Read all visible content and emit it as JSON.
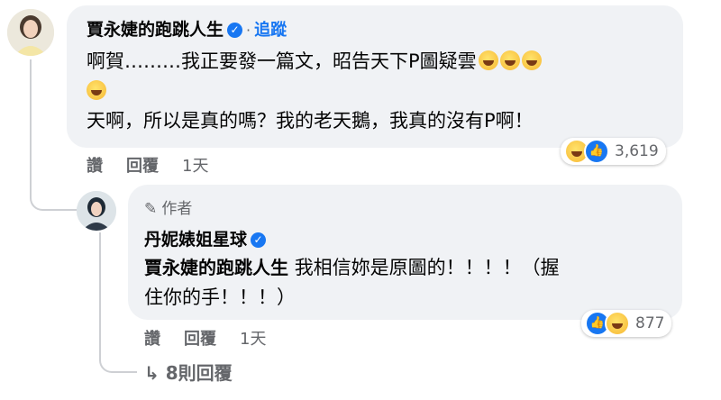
{
  "comment": {
    "author": "賈永婕的跑跳人生",
    "follow_label": "追蹤",
    "line1": "啊賀………我正要發一篇文，昭告天下P圖疑雲",
    "line3": "天啊，所以是真的嗎？我的老天鵝，我真的沒有P啊！",
    "like_label": "讚",
    "reply_label": "回覆",
    "time": "1天",
    "reaction_count": "3,619"
  },
  "reply": {
    "author_tag": "作者",
    "author": "丹妮婊姐星球",
    "mention": "賈永婕的跑跳人生",
    "text_line1": "我相信妳是原圖的！！！！（握",
    "text_line2": "住你的手！！！）",
    "like_label": "讚",
    "reply_label": "回覆",
    "time": "1天",
    "reaction_count": "877"
  },
  "more_replies": "8則回覆",
  "icons": {
    "verified": "verified-badge-icon",
    "laugh": "laughing-emoji-icon",
    "like": "like-reaction-icon",
    "pencil": "pencil-icon",
    "reply_arrow": "reply-arrow-icon"
  },
  "colors": {
    "link": "#1877f2",
    "bubble": "#f0f2f5",
    "muted": "#65676b"
  }
}
